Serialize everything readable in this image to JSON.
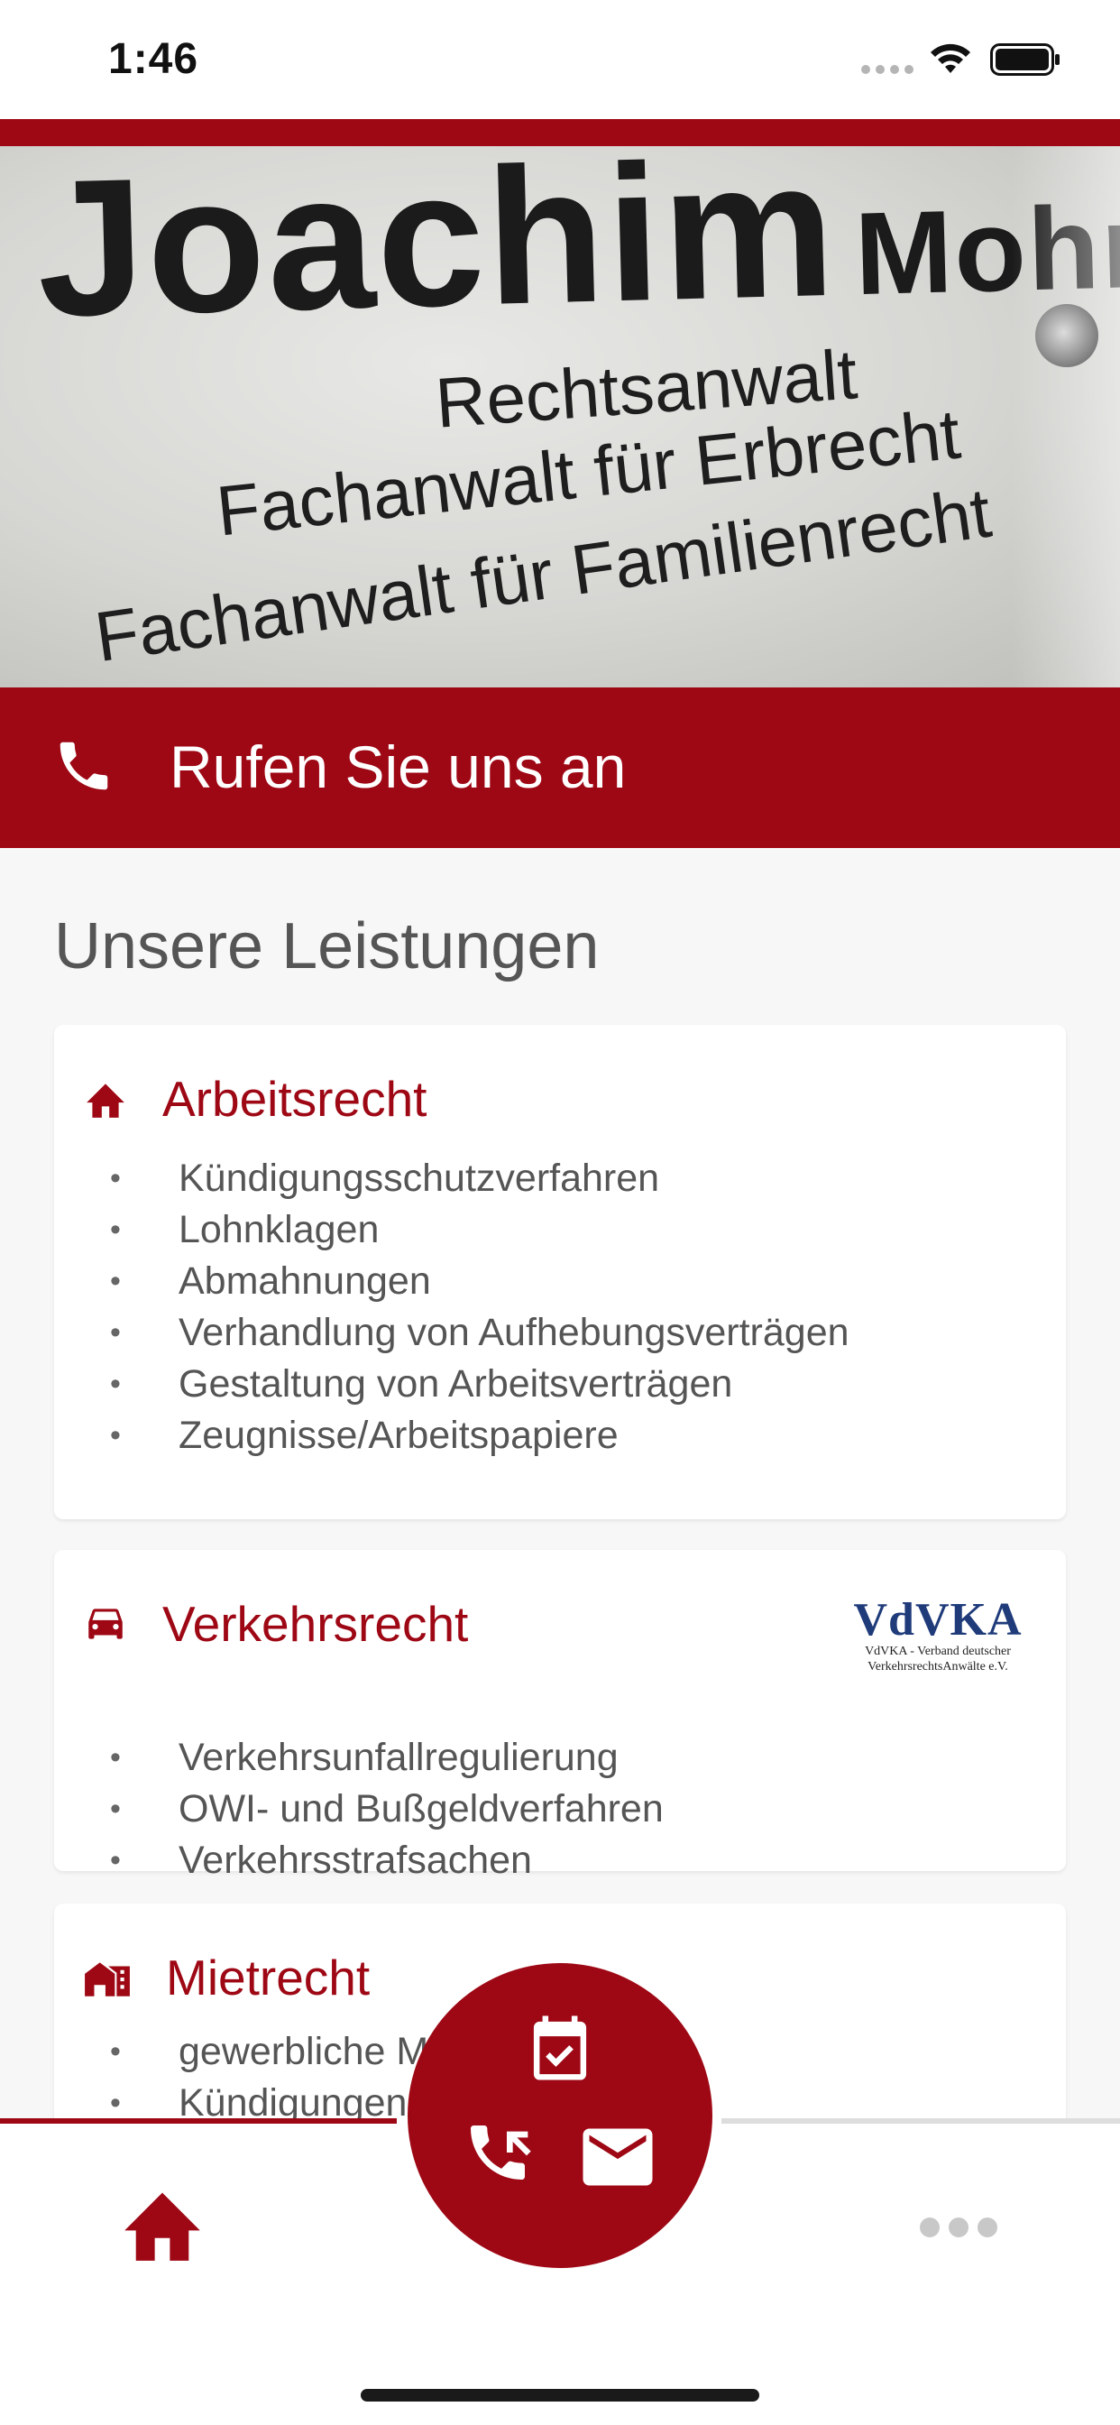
{
  "status_bar": {
    "time": "1:46",
    "icons": [
      "signal-icon",
      "wifi-icon",
      "battery-icon"
    ]
  },
  "hero": {
    "sign_line1_name": "Joachim",
    "sign_line1_surname": "Mohr",
    "sign_line2": "Rechtsanwalt",
    "sign_line3": "Fachanwalt für Erbrecht",
    "sign_line4": "Fachanwalt für Familienrecht"
  },
  "call_bar": {
    "icon": "phone-icon",
    "label": "Rufen Sie uns an"
  },
  "main": {
    "section_title": "Unsere Leistungen",
    "cards": [
      {
        "icon": "home-icon",
        "title": "Arbeitsrecht",
        "items": [
          "Kündigungsschutzverfahren",
          "Lohnklagen",
          "Abmahnungen",
          "Verhandlung von Aufhebungsverträgen",
          "Gestaltung von Arbeitsverträgen",
          "Zeugnisse/Arbeitspapiere"
        ]
      },
      {
        "icon": "car-icon",
        "title": "Verkehrsrecht",
        "logo_mark": "VdVKA",
        "logo_sub1": "VdVKA - Verband deutscher",
        "logo_sub2": "VerkehrsrechtsAnwälte e.V.",
        "items": [
          "Verkehrsunfallregulierung",
          "OWI- und Bußgeldverfahren",
          "Verkehrsstrafsachen"
        ]
      },
      {
        "icon": "building-icon",
        "title": "Mietrecht",
        "items": [
          "gewerbliche Mietverträge",
          "Kündigungen"
        ]
      }
    ]
  },
  "bottom_nav": {
    "home_icon": "home-icon",
    "more_icon": "more-icon"
  },
  "fab": {
    "icons": [
      "calendar-check-icon",
      "phone-incoming-icon",
      "mail-icon"
    ]
  },
  "colors": {
    "brand_red": "#9e0815",
    "background": "#f7f7f7"
  }
}
